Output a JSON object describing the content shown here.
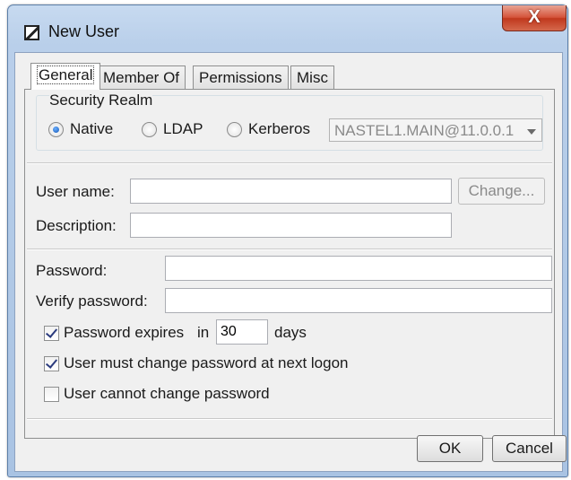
{
  "window": {
    "title": "New User",
    "close_label": "X"
  },
  "tabs": [
    {
      "label": "General",
      "active": true
    },
    {
      "label": "Member Of",
      "active": false
    },
    {
      "label": "Permissions",
      "active": false
    },
    {
      "label": "Misc",
      "active": false
    }
  ],
  "security_realm": {
    "legend": "Security Realm",
    "options": [
      {
        "label": "Native",
        "selected": true
      },
      {
        "label": "LDAP",
        "selected": false
      },
      {
        "label": "Kerberos",
        "selected": false
      }
    ],
    "domain_value": "NASTEL1.MAIN@11.0.0.1"
  },
  "user": {
    "username_label": "User name:",
    "username_value": "",
    "change_label": "Change...",
    "description_label": "Description:",
    "description_value": ""
  },
  "password": {
    "password_label": "Password:",
    "password_value": "",
    "verify_label": "Verify password:",
    "verify_value": "",
    "expires_label": "Password expires",
    "expires_in_label": "in",
    "expires_days_value": "30",
    "expires_days_unit": "days",
    "expires_checked": true,
    "must_change_label": "User must change password at next logon",
    "must_change_checked": true,
    "cannot_change_label": "User cannot change password",
    "cannot_change_checked": false
  },
  "buttons": {
    "ok_label": "OK",
    "cancel_label": "Cancel"
  },
  "colors": {
    "title_bar": "#b9cfea",
    "close_button": "#c0381d",
    "checkbox_mark": "#2b3b7e",
    "radio_dot": "#1456b5"
  },
  "icons": {
    "app": "window-icon",
    "close": "close-icon",
    "dropdown": "chevron-down-icon"
  }
}
